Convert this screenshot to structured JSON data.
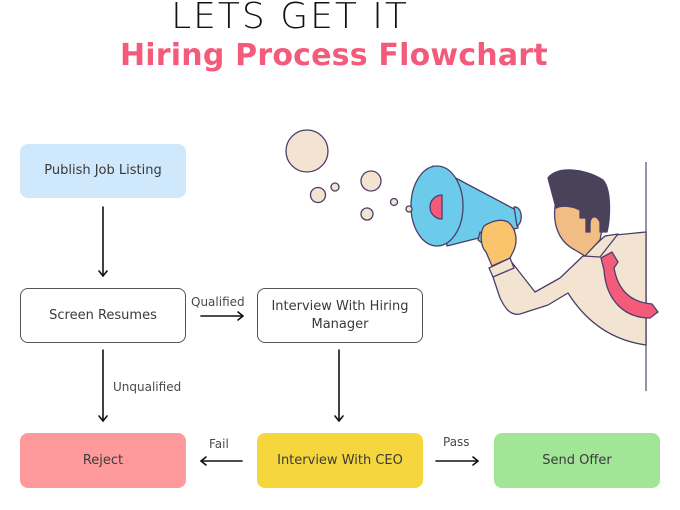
{
  "header": {
    "top_title": "LETS GET IT",
    "main_title": "Hiring Process Flowchart",
    "main_title_color": "#f45b7a"
  },
  "nodes": {
    "publish": {
      "label": "Publish Job Listing",
      "color": "#cfe8fc"
    },
    "screen": {
      "label": "Screen Resumes",
      "color": "#ffffff"
    },
    "interview_manager": {
      "label": "Interview With Hiring Manager",
      "color": "#ffffff"
    },
    "reject": {
      "label": "Reject",
      "color": "#fe9a9c"
    },
    "interview_ceo": {
      "label": "Interview With CEO",
      "color": "#f5d63d"
    },
    "offer": {
      "label": "Send Offer",
      "color": "#a3e597"
    }
  },
  "edges": {
    "publish_to_screen": {
      "label": ""
    },
    "screen_to_manager": {
      "label": "Qualified"
    },
    "screen_to_reject": {
      "label": "Unqualified"
    },
    "manager_to_ceo": {
      "label": ""
    },
    "ceo_to_reject": {
      "label": "Fail"
    },
    "ceo_to_offer": {
      "label": "Pass"
    }
  },
  "illustration": {
    "description": "man-shouting-into-megaphone",
    "megaphone_color": "#6ccbeb",
    "tie_color": "#f45b7a",
    "hair_color": "#4a4259",
    "skin_color": "#f2bd85",
    "shirt_color": "#f3e4d2"
  }
}
